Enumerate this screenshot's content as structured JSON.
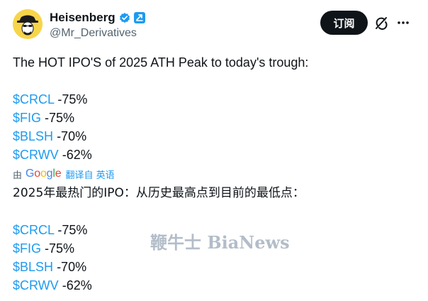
{
  "author": {
    "display_name": "Heisenberg",
    "handle": "@Mr_Derivatives",
    "avatar_icon": "heisenberg-portrait-avatar",
    "verified_icon": "blue-verified-badge",
    "affiliation_icon": "blue-square-affiliation-badge"
  },
  "actions": {
    "subscribe_label": "订阅",
    "grok_icon": "grok-slash-icon",
    "more_icon": "more-dots-icon"
  },
  "post": {
    "headline": "The HOT IPO'S of 2025 ATH Peak to today's trough:",
    "items": [
      {
        "ticker": "$CRCL",
        "change": "-75%"
      },
      {
        "ticker": "$FIG",
        "change": "-75%"
      },
      {
        "ticker": "$BLSH",
        "change": "-70%"
      },
      {
        "ticker": "$CRWV",
        "change": "-62%"
      }
    ]
  },
  "translation": {
    "prefix": "由",
    "provider": "Google",
    "link_label": "翻译自 英语",
    "headline": "2025年最热门的IPO：从历史最高点到目前的最低点：",
    "items": [
      {
        "ticker": "$CRCL",
        "change": "-75%"
      },
      {
        "ticker": "$FIG",
        "change": "-75%"
      },
      {
        "ticker": "$BLSH",
        "change": "-70%"
      },
      {
        "ticker": "$CRWV",
        "change": "-62%"
      }
    ]
  },
  "watermark": "鞭牛士 BiaNews",
  "colors": {
    "link": "#1d9bf0",
    "text": "#0f1419",
    "secondary": "#536471",
    "button_bg": "#0f1419",
    "verified": "#1d9bf0",
    "avatar_bg": "#f7d54a"
  }
}
